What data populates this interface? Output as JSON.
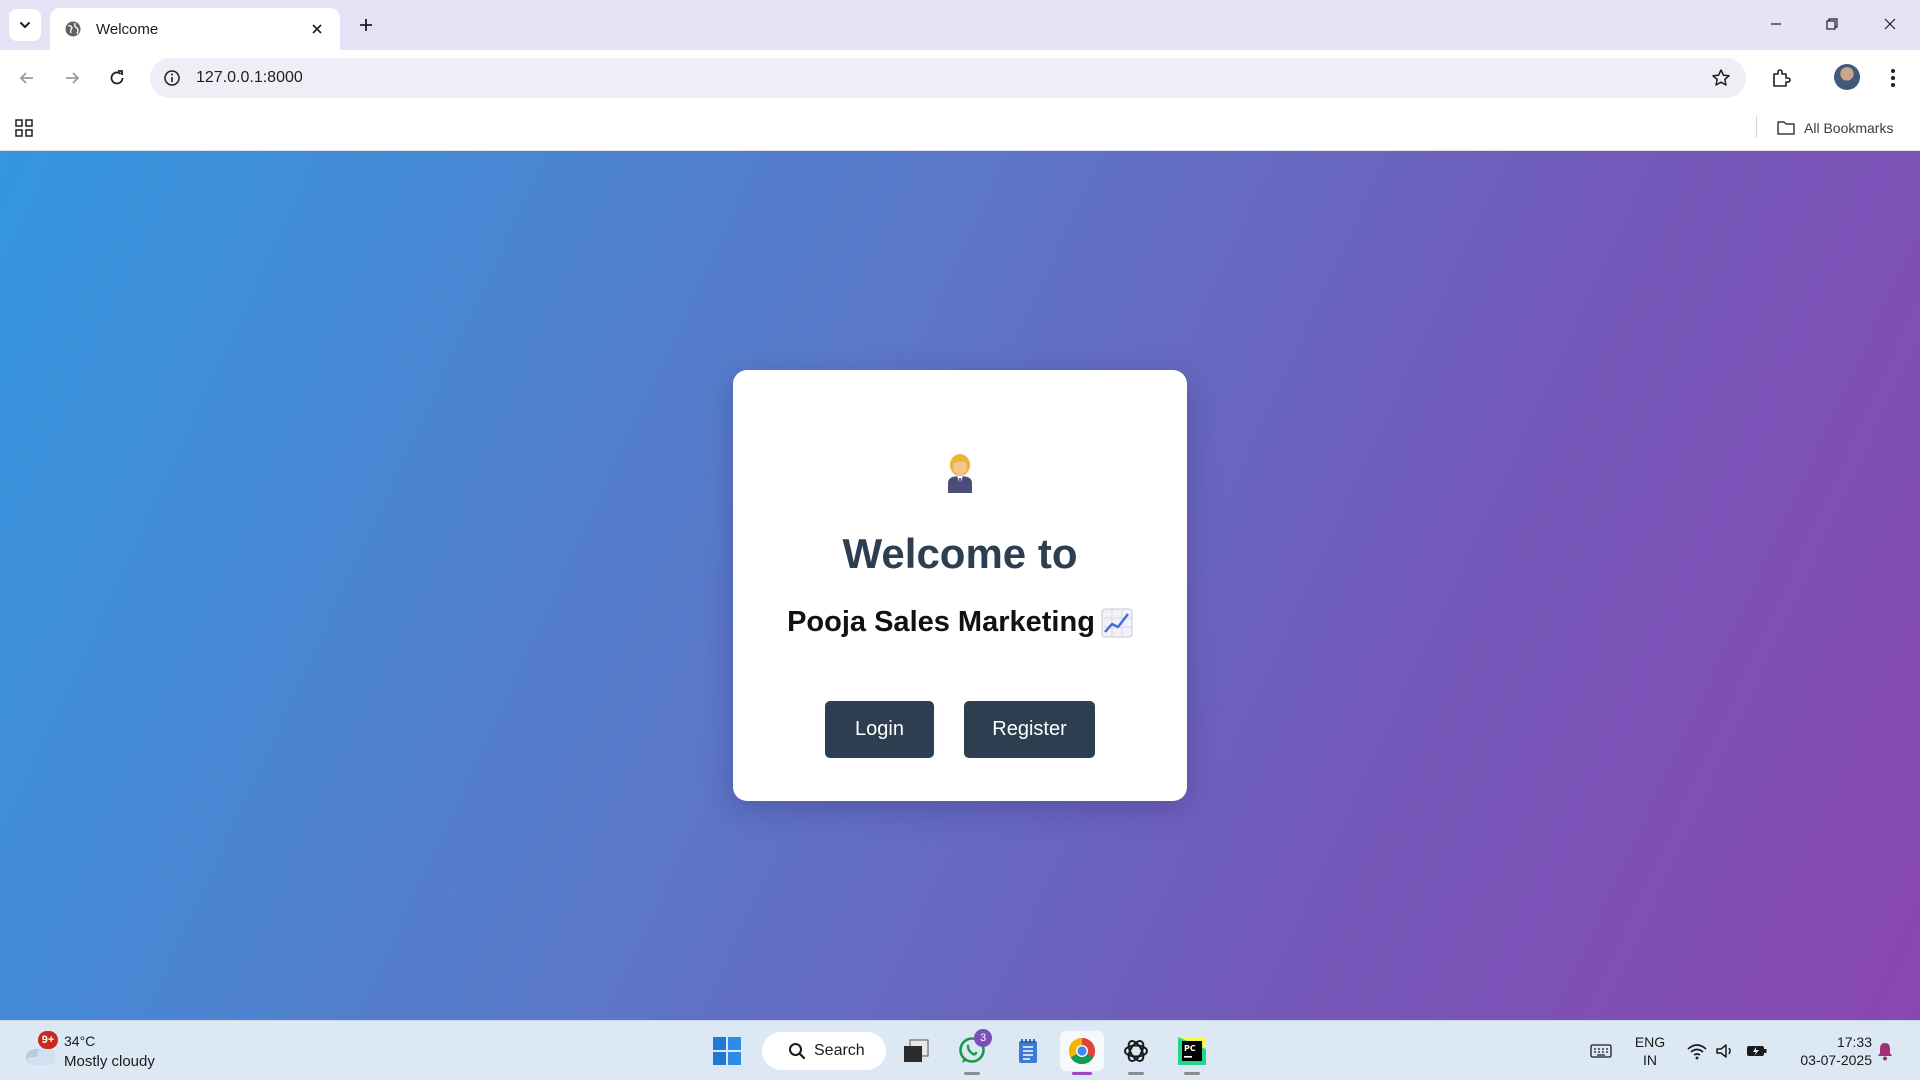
{
  "browser": {
    "tab_title": "Welcome",
    "url": "127.0.0.1:8000",
    "all_bookmarks_label": "All Bookmarks"
  },
  "page": {
    "icon_emoji": "🙎",
    "heading": "Welcome to",
    "subheading": "Pooja Sales Marketing",
    "login_label": "Login",
    "register_label": "Register",
    "colors": {
      "gradient_start": "#3497df",
      "gradient_end": "#8a47b2",
      "button_bg": "#2c3e50",
      "heading_color": "#2c3e50"
    }
  },
  "taskbar": {
    "weather_badge": "9+",
    "temperature": "34°C",
    "condition": "Mostly cloudy",
    "search_label": "Search",
    "whatsapp_count": "3",
    "lang_line1": "ENG",
    "lang_line2": "IN",
    "time": "17:33",
    "date": "03-07-2025",
    "apps": [
      "file-explorer",
      "whatsapp",
      "notepad",
      "chrome",
      "chatgpt",
      "pycharm"
    ]
  }
}
